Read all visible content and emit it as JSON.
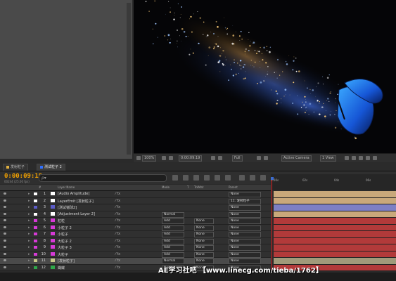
{
  "viewer_bar": {
    "zoom": "100%",
    "timecode": "0:00:09:19",
    "resolution": "Full",
    "camera": "Active Camera",
    "views": "1 View"
  },
  "tabs": [
    {
      "label": "发射粒子",
      "color": "#e0b040",
      "active": false
    },
    {
      "label": "测试粒子 2",
      "color": "#3070ff",
      "active": true
    }
  ],
  "timeline": {
    "timecode": "0:00:09:19",
    "fps": "00244 (25.00 fps)",
    "search_placeholder": "ρ▾"
  },
  "columns": {
    "label_hash": "#",
    "layer_name": "Layer Name",
    "mode": "Mode",
    "t": "T",
    "trkmat": "TrkMat",
    "parent": "Parent"
  },
  "ruler_ticks": [
    "0:00s",
    "02s",
    "04s",
    "06s"
  ],
  "layers": [
    {
      "num": "1",
      "name": "[Audio Amplitude]",
      "label": "#ffffff",
      "mode": "",
      "trkmat": "",
      "parent": "None",
      "bar": "#c9a87a"
    },
    {
      "num": "2",
      "name": "LayerEmit [发射粒子]",
      "label": "#ffffff",
      "mode": "",
      "trkmat": "",
      "parent": "11. 发射粒子",
      "bar": "#c9a87a"
    },
    {
      "num": "3",
      "name": "[测试锚球2]",
      "label": "#5c5cc9",
      "mode": "",
      "trkmat": "",
      "parent": "None",
      "bar": "#7d7fc4"
    },
    {
      "num": "4",
      "name": "[Adjustment Layer 2]",
      "label": "#ffffff",
      "mode": "Normal",
      "trkmat": "",
      "parent": "None",
      "bar": "#c9a87a"
    },
    {
      "num": "5",
      "name": "粒粒",
      "label": "#d63ad6",
      "mode": "Add",
      "trkmat": "None",
      "parent": "None",
      "bar": "#b23a3a"
    },
    {
      "num": "6",
      "name": "小粒子 2",
      "label": "#d63ad6",
      "mode": "Add",
      "trkmat": "None",
      "parent": "None",
      "bar": "#b23a3a"
    },
    {
      "num": "7",
      "name": "小粒子",
      "label": "#d63ad6",
      "mode": "Add",
      "trkmat": "None",
      "parent": "None",
      "bar": "#b23a3a"
    },
    {
      "num": "8",
      "name": "大粒子 2",
      "label": "#d63ad6",
      "mode": "Add",
      "trkmat": "None",
      "parent": "None",
      "bar": "#b23a3a"
    },
    {
      "num": "9",
      "name": "大粒子 3",
      "label": "#d63ad6",
      "mode": "Add",
      "trkmat": "None",
      "parent": "None",
      "bar": "#b23a3a"
    },
    {
      "num": "10",
      "name": "大粒子",
      "label": "#d63ad6",
      "mode": "Add",
      "trkmat": "None",
      "parent": "None",
      "bar": "#b23a3a"
    },
    {
      "num": "11",
      "name": "[发射粒子]",
      "label": "#c9c98a",
      "mode": "Normal",
      "trkmat": "None",
      "parent": "None",
      "bar": "#a09a7a"
    },
    {
      "num": "12",
      "name": "蝴蝶",
      "label": "#2ea84a",
      "mode": "Normal",
      "trkmat": "None",
      "parent": "None",
      "bar": "#b23a3a"
    }
  ],
  "watermark": "AE学习社吧 【www.linecg.com/tieba/1762】"
}
